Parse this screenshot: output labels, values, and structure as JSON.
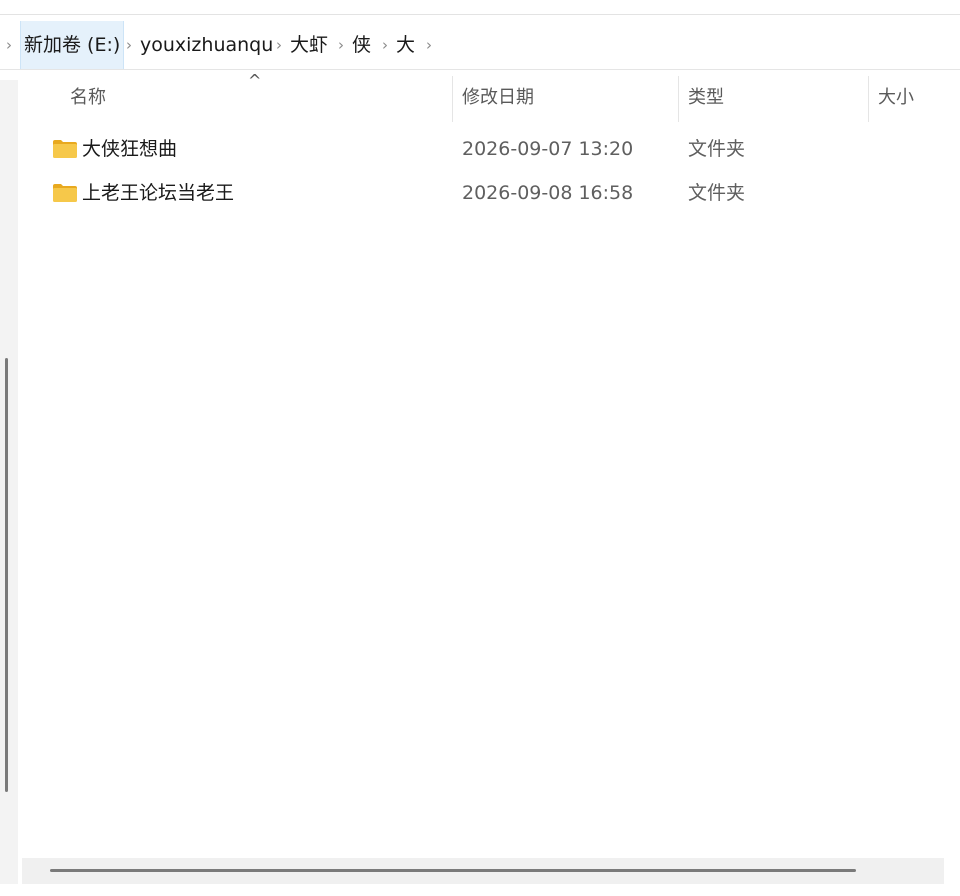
{
  "breadcrumb": {
    "items": [
      {
        "label": "新加卷 (E:)"
      },
      {
        "label": "youxizhuanqu"
      },
      {
        "label": "大虾"
      },
      {
        "label": "侠"
      },
      {
        "label": "大"
      }
    ],
    "separator": "›"
  },
  "columns": {
    "name": "名称",
    "modified": "修改日期",
    "type": "类型",
    "size": "大小",
    "sort_indicator": "^"
  },
  "files": [
    {
      "name": "大侠狂想曲",
      "modified": "2026-09-07 13:20",
      "type": "文件夹",
      "size": ""
    },
    {
      "name": "上老王论坛当老王",
      "modified": "2026-09-08 16:58",
      "type": "文件夹",
      "size": ""
    }
  ],
  "colors": {
    "folder_body": "#f6c84a",
    "folder_tab": "#e8a91f",
    "highlight": "#e5f1fb"
  }
}
